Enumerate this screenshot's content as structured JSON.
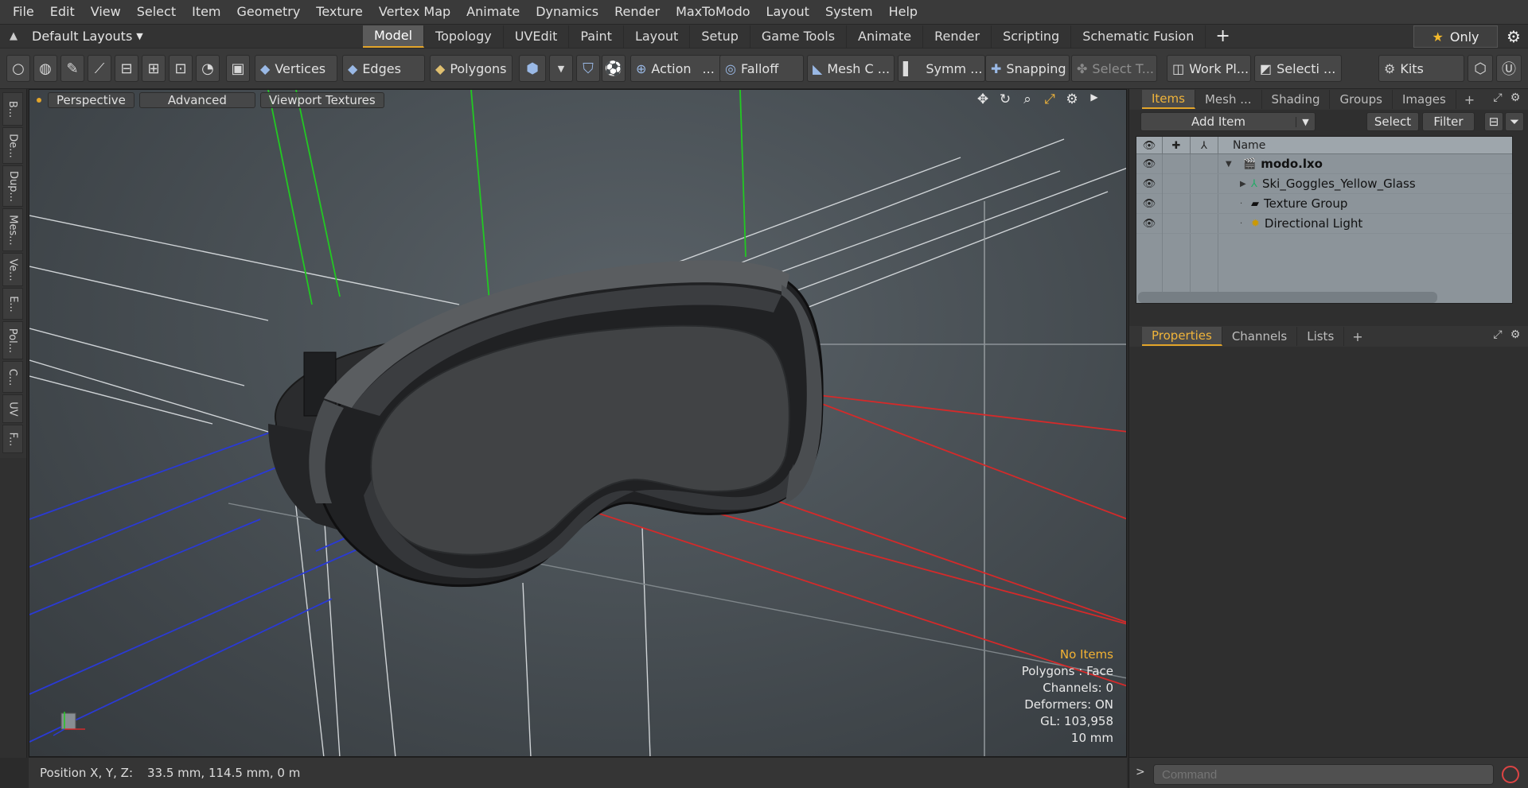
{
  "menu": [
    "File",
    "Edit",
    "View",
    "Select",
    "Item",
    "Geometry",
    "Texture",
    "Vertex Map",
    "Animate",
    "Dynamics",
    "Render",
    "MaxToModo",
    "Layout",
    "System",
    "Help"
  ],
  "layoutbar": {
    "layouts_label": "Default Layouts",
    "tabs": [
      "Model",
      "Topology",
      "UVEdit",
      "Paint",
      "Layout",
      "Setup",
      "Game Tools",
      "Animate",
      "Render",
      "Scripting",
      "Schematic Fusion"
    ],
    "active_tab": "Model",
    "only_label": "Only"
  },
  "toolbar": {
    "vertices": "Vertices",
    "edges": "Edges",
    "polygons": "Polygons",
    "action": "Action",
    "falloff": "Falloff",
    "mesh_c": "Mesh C ...",
    "symm": "Symm ...",
    "snapping": "Snapping",
    "select_t": "Select T...",
    "work_pl": "Work Pl...",
    "selecti": "Selecti ...",
    "kits": "Kits"
  },
  "lefttabs": [
    "B...",
    "De...",
    "Dup...",
    "Mes...",
    "Ve...",
    "E...",
    "Pol...",
    "C...",
    "UV",
    "F..."
  ],
  "viewport": {
    "perspective": "Perspective",
    "advanced": "Advanced",
    "viewport_textures": "Viewport Textures",
    "info": {
      "no_items": "No Items",
      "polygons": "Polygons : Face",
      "channels": "Channels: 0",
      "deformers": "Deformers: ON",
      "gl": "GL: 103,958",
      "scale": "10 mm"
    }
  },
  "status": {
    "label": "Position X, Y, Z:",
    "value": "33.5 mm, 114.5 mm, 0 m"
  },
  "rightpanel": {
    "tabs": [
      "Items",
      "Mesh ...",
      "Shading",
      "Groups",
      "Images"
    ],
    "active_tab": "Items",
    "add_item": "Add Item",
    "select": "Select",
    "filter": "Filter",
    "name_header": "Name",
    "items": [
      {
        "name": "modo.lxo",
        "bold": true
      },
      {
        "name": "Ski_Goggles_Yellow_Glass"
      },
      {
        "name": "Texture Group"
      },
      {
        "name": "Directional Light"
      }
    ],
    "prop_tabs": [
      "Properties",
      "Channels",
      "Lists"
    ],
    "prop_active": "Properties",
    "command_placeholder": "Command"
  },
  "colors": {
    "accent": "#e3a52a",
    "axis_x": "#d42a2a",
    "axis_y": "#22c922",
    "axis_z": "#2a3ad4"
  }
}
